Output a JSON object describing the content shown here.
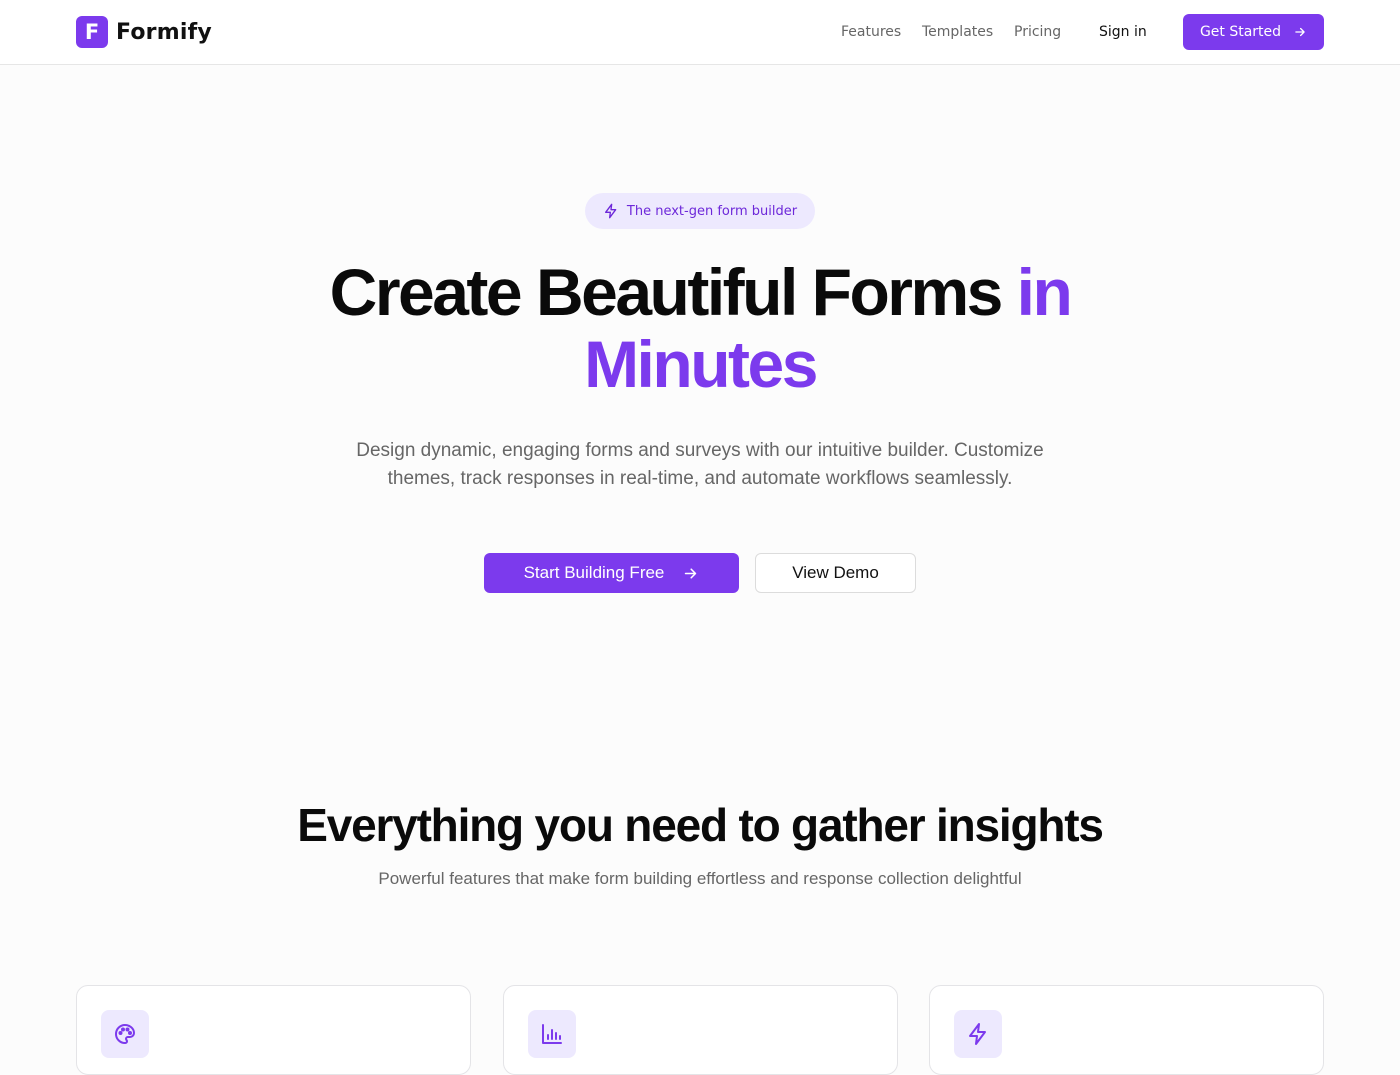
{
  "brand": {
    "logo_letter": "F",
    "name": "Formify",
    "accent_color": "#7c3aed"
  },
  "nav": {
    "links": [
      "Features",
      "Templates",
      "Pricing"
    ],
    "sign_in": "Sign in",
    "cta": "Get Started"
  },
  "hero": {
    "badge": "The next-gen form builder",
    "title_part1": "Create Beautiful Forms ",
    "title_accent": "in Minutes",
    "subtitle": "Design dynamic, engaging forms and surveys with our intuitive builder. Customize themes, track responses in real-time, and automate workflows seamlessly.",
    "primary_button": "Start Building Free",
    "secondary_button": "View Demo"
  },
  "features": {
    "title": "Everything you need to gather insights",
    "subtitle": "Powerful features that make form building effortless and response collection delightful",
    "cards": [
      {
        "icon": "palette-icon"
      },
      {
        "icon": "bar-chart-icon"
      },
      {
        "icon": "lightning-icon"
      }
    ]
  }
}
